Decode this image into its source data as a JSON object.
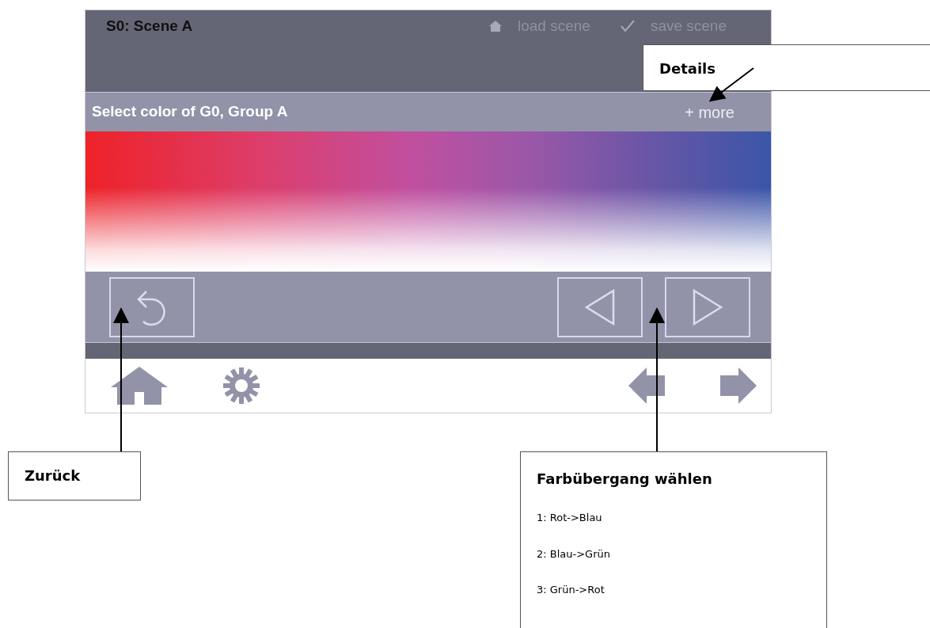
{
  "screen": {
    "scene_title": "S0: Scene A",
    "actions": [
      {
        "kind": "load",
        "label": "load scene"
      },
      {
        "kind": "save",
        "label": "save scene"
      }
    ],
    "section_title": "Select color of G0, Group A",
    "more_link": "+ more"
  },
  "callouts": [
    {
      "kind": "details",
      "title": "Details"
    },
    {
      "kind": "back",
      "title": "Zurück"
    },
    {
      "kind": "transition",
      "title": "Farbübergang wählen",
      "items": [
        "1: Rot->Blau",
        "2: Blau->Grün",
        "3: Grün->Rot"
      ]
    }
  ]
}
